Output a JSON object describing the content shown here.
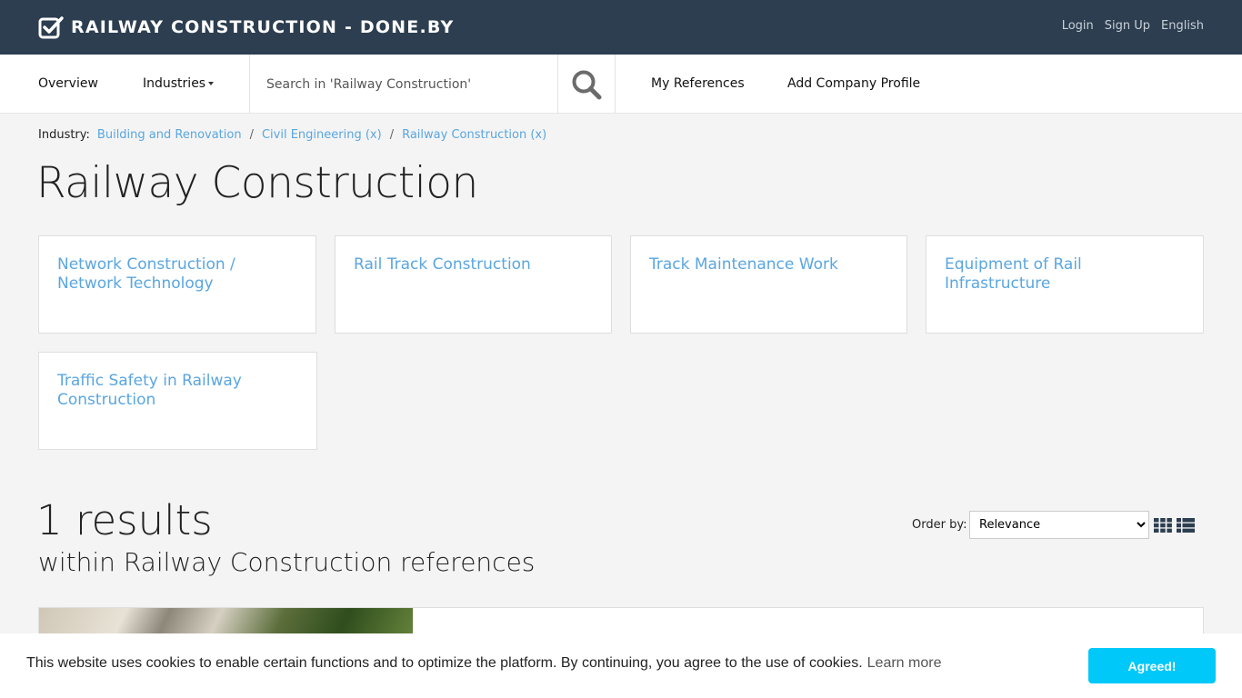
{
  "brand": {
    "title": "RAILWAY CONSTRUCTION - DONE.BY"
  },
  "top_links": {
    "login": "Login",
    "signup": "Sign Up",
    "language": "English"
  },
  "nav": {
    "overview": "Overview",
    "industries": "Industries",
    "search_placeholder": "Search in 'Railway Construction'",
    "my_references": "My References",
    "add_company_profile": "Add Company Profile"
  },
  "breadcrumb": {
    "label": "Industry:",
    "items": [
      "Building and Renovation",
      "Civil Engineering (x)",
      "Railway Construction (x)"
    ],
    "separator": "/"
  },
  "page_title": "Railway Construction",
  "subcategories": [
    "Network Construction / Network Technology",
    "Rail Track Construction",
    "Track Maintenance Work",
    "Equipment of Rail Infrastructure",
    "Traffic Safety in Railway Construction"
  ],
  "results": {
    "count": "1 results",
    "subtitle": "within Railway Construction references",
    "order_label": "Order by:",
    "order_selected": "Relevance"
  },
  "cookie": {
    "text": "This website uses cookies to enable certain functions and to optimize the platform. By continuing, you agree to the use of cookies.",
    "learn_more": "Learn more",
    "button": "Agreed!"
  },
  "colors": {
    "topbar": "#2c3e50",
    "link": "#5aa6e0",
    "accept_button": "#00c8f8"
  },
  "icons": {
    "brand": "check-square-icon",
    "search": "search-icon",
    "grid_view": "grid-view-icon",
    "list_view": "list-view-icon"
  }
}
